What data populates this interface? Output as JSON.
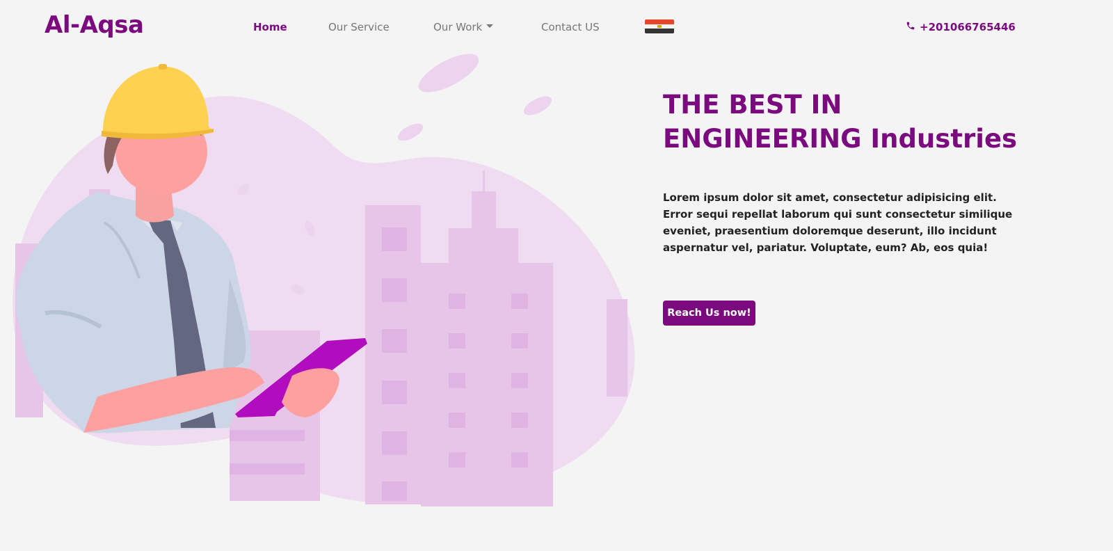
{
  "brand": "Al-Aqsa",
  "nav": {
    "home": "Home",
    "service": "Our Service",
    "work": "Our Work",
    "contact": "Contact US"
  },
  "phone": "+201066765446",
  "icons": {
    "phone": "phone-icon",
    "flag": "egypt-flag-icon",
    "dropdown": "caret-down-icon"
  },
  "hero": {
    "title_line1": "THE BEST IN",
    "title_line2": "ENGINEERING Industries",
    "text": "Lorem ipsum dolor sit amet, consectetur adipisicing elit. Error sequi repellat laborum qui sunt consectetur similique eveniet, praesentium doloremque deserunt, illo incidunt aspernatur vel, pariatur. Voluptate, eum? Ab, eos quia!",
    "button": "Reach Us now!"
  },
  "colors": {
    "accent": "#7a0a7d",
    "background": "#f4f4f4",
    "blob": "#efd9f0",
    "tablet": "#b10cbd",
    "helmet": "#ffd150"
  }
}
